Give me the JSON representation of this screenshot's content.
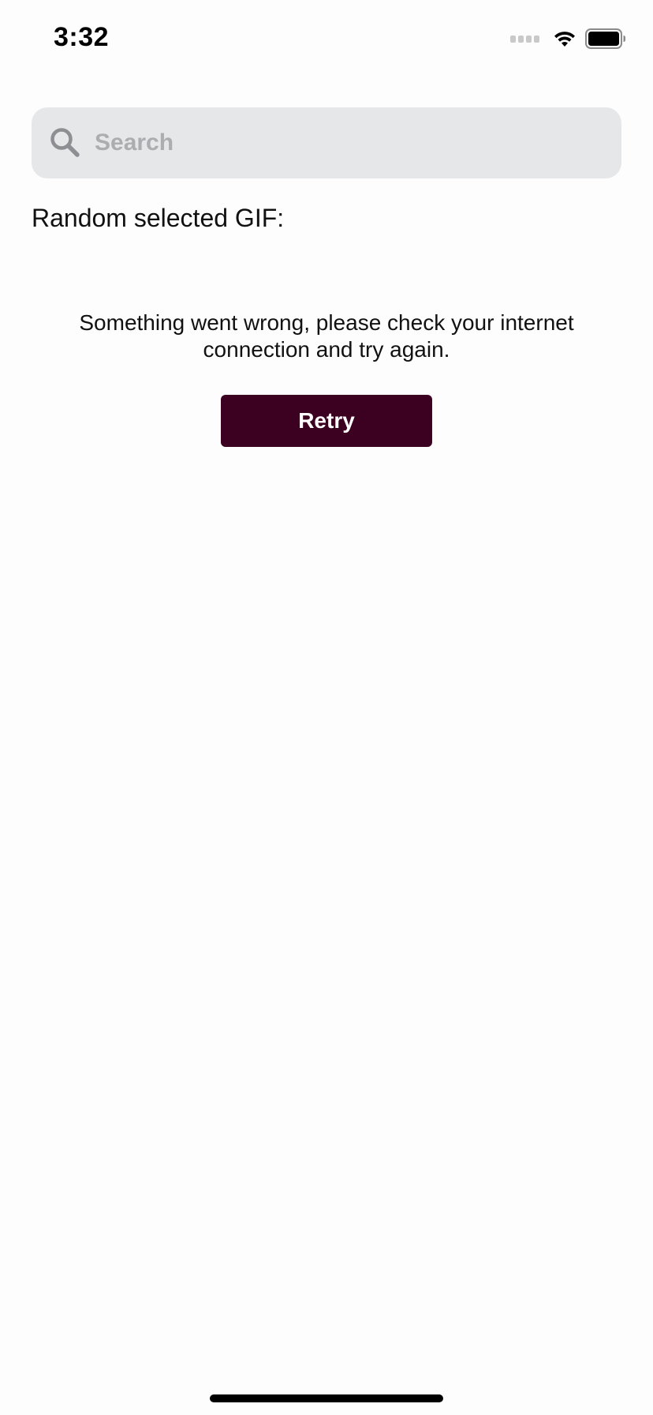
{
  "status_bar": {
    "time": "3:32",
    "icons": [
      "cellular-signal-icon",
      "wifi-icon",
      "battery-icon"
    ]
  },
  "search": {
    "placeholder": "Search",
    "value": "",
    "icon": "search-icon"
  },
  "main": {
    "random_label": "Random selected GIF:",
    "error_message": "Something went wrong, please check your internet connection and try again.",
    "retry_label": "Retry"
  },
  "colors": {
    "background": "#fefdfd",
    "search_background": "#e6e7e9",
    "retry_button": "#3c0020",
    "placeholder": "#adadb1"
  }
}
